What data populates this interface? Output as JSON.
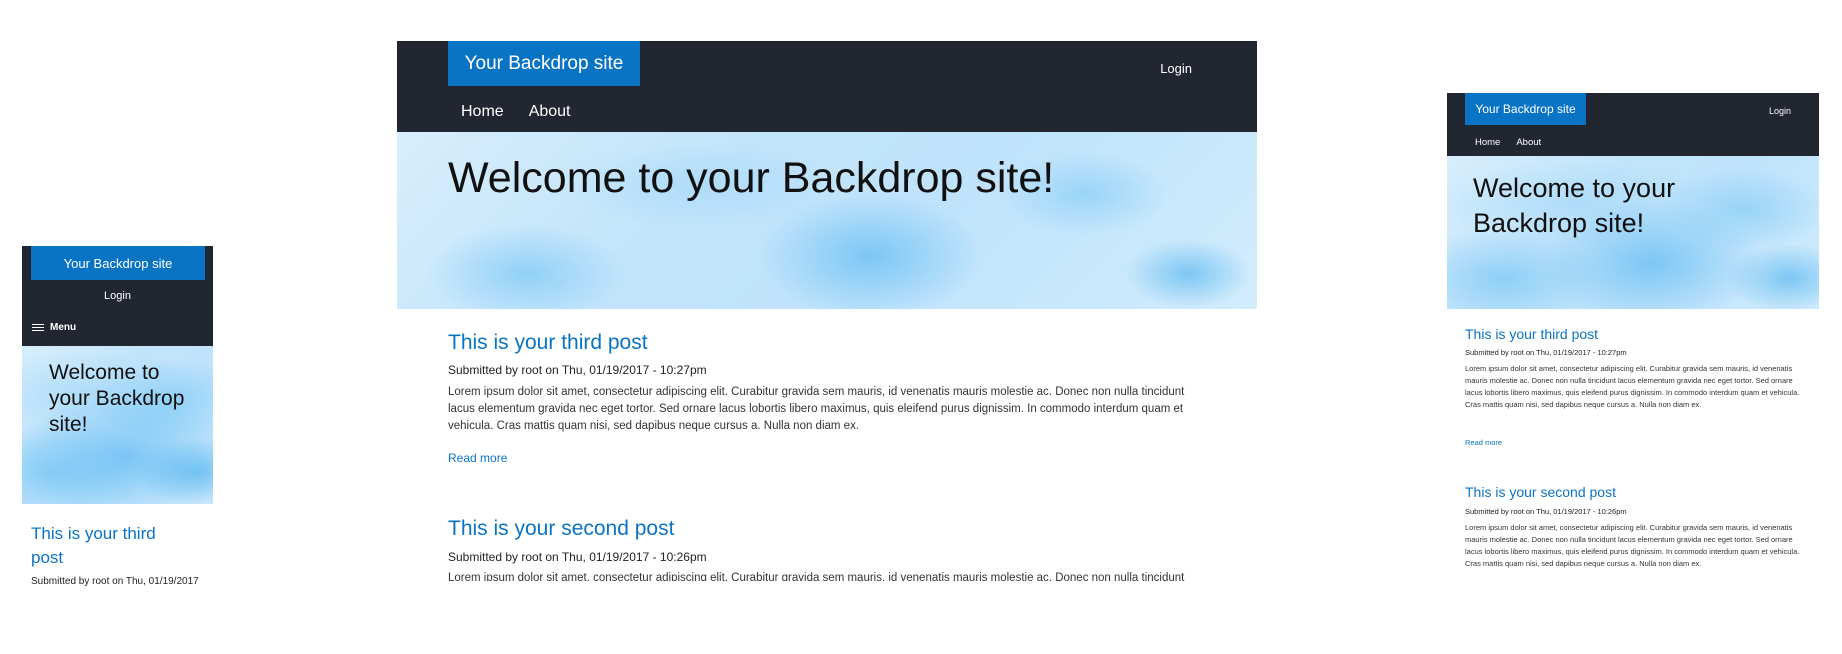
{
  "site": {
    "brand": "Your Backdrop site",
    "login": "Login",
    "menu_label": "Menu",
    "nav": [
      "Home",
      "About"
    ],
    "hero_title": "Welcome to your Backdrop site!",
    "read_more": "Read more"
  },
  "posts": [
    {
      "title": "This is your third post",
      "meta": "Submitted by root on Thu, 01/19/2017 - 10:27pm",
      "meta_short": "Submitted by root on Thu, 01/19/2017",
      "body": "Lorem ipsum dolor sit amet, consectetur adipiscing elit. Curabitur gravida sem mauris, id venenatis mauris molestie ac. Donec non nulla tincidunt lacus elementum gravida nec eget tortor. Sed ornare lacus lobortis libero maximus, quis eleifend purus dignissim. In commodo interdum quam et vehicula. Cras mattis quam nisi, sed dapibus neque cursus a. Nulla non diam ex."
    },
    {
      "title": "This is your second post",
      "meta": "Submitted by root on Thu, 01/19/2017 - 10:26pm",
      "body": "Lorem ipsum dolor sit amet, consectetur adipiscing elit. Curabitur gravida sem mauris, id venenatis mauris molestie ac. Donec non nulla tincidunt lacus elementum gravida nec eget tortor. Sed ornare lacus lobortis libero maximus, quis eleifend purus dignissim. In commodo interdum quam et vehicula. Cras mattis quam nisi, sed dapibus neque cursus a. Nulla non diam ex."
    }
  ],
  "colors": {
    "header_bg": "#222630",
    "brand_bg": "#0a74c4",
    "link": "#0a74c4",
    "hero_bg": "#c8e8fb"
  },
  "icons": {
    "menu": "hamburger-icon"
  }
}
